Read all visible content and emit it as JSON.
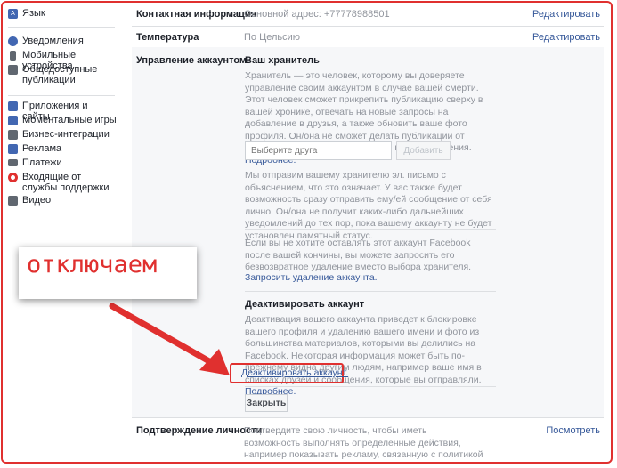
{
  "sidebar": {
    "items": [
      {
        "label": "Язык",
        "icon": "language-icon"
      },
      {
        "label": "Уведомления",
        "icon": "globe-icon"
      },
      {
        "label": "Мобильные устройства",
        "icon": "mobile-icon"
      },
      {
        "label": "Общедоступные публикации",
        "icon": "rss-icon"
      },
      {
        "label": "Приложения и сайты",
        "icon": "apps-icon"
      },
      {
        "label": "Моментальные игры",
        "icon": "games-icon"
      },
      {
        "label": "Бизнес-интеграции",
        "icon": "business-icon"
      },
      {
        "label": "Реклама",
        "icon": "ads-icon"
      },
      {
        "label": "Платежи",
        "icon": "payments-icon"
      },
      {
        "label": "Входящие от службы поддержки",
        "icon": "support-icon"
      },
      {
        "label": "Видео",
        "icon": "video-icon"
      }
    ]
  },
  "rows": {
    "contact": {
      "label": "Контактная информация",
      "value": "Основной адрес: +77778988501",
      "link": "Редактировать"
    },
    "temperature": {
      "label": "Температура",
      "value": "По Цельсию",
      "link": "Редактировать"
    },
    "identity": {
      "label": "Подтверждение личности",
      "value": "Подтвердите свою личность, чтобы иметь возможность выполнять определенные действия, например показывать рекламу, связанную с политикой и вопросами государственного значения.",
      "link": "Посмотреть"
    }
  },
  "account": {
    "label": "Управление аккаунтом",
    "legacy": {
      "title": "Ваш хранитель",
      "description": "Хранитель — это человек, которому вы доверяете управление своим аккаунтом в случае вашей смерти. Этот человек сможет прикрепить публикацию сверху в вашей хронике, отвечать на новые запросы на добавление в друзья, а также обновить ваше фото профиля. Он/она не сможет делать публикации от вашего имени или просматривать ваши сообщения.",
      "more_link": "Подробнее.",
      "friend_placeholder": "Выберите друга",
      "add_button": "Добавить",
      "notice": "Мы отправим вашему хранителю эл. письмо с объяснением, что это означает. У вас также будет возможность сразу отправить ему/ей сообщение от себя лично. Он/она не получит каких-либо дальнейших уведомлений до тех пор, пока вашему аккаунту не будет установлен памятный статус.",
      "delete_text": "Если вы не хотите оставлять этот аккаунт Facebook после вашей кончины, вы можете запросить его безвозвратное удаление вместо выбора хранителя.",
      "delete_link": "Запросить удаление аккаунта."
    },
    "deactivate": {
      "title": "Деактивировать аккаунт",
      "description": "Деактивация вашего аккаунта приведет к блокировке вашего профиля и удалению вашего имени и фото из большинства материалов, которыми вы делились на Facebook. Некоторая информация может быть по-прежнему видна другим людям, например ваше имя в списках друзей и сообщения, которые вы отправляли.",
      "more_link": "Подробнее.",
      "link": "Деактивировать аккаунт."
    },
    "close_button": "Закрыть"
  },
  "annotation": {
    "text": "отключаем",
    "color": "#e0302f"
  },
  "colors": {
    "link": "#365899",
    "muted": "#90949c",
    "annotation": "#e0302f"
  }
}
